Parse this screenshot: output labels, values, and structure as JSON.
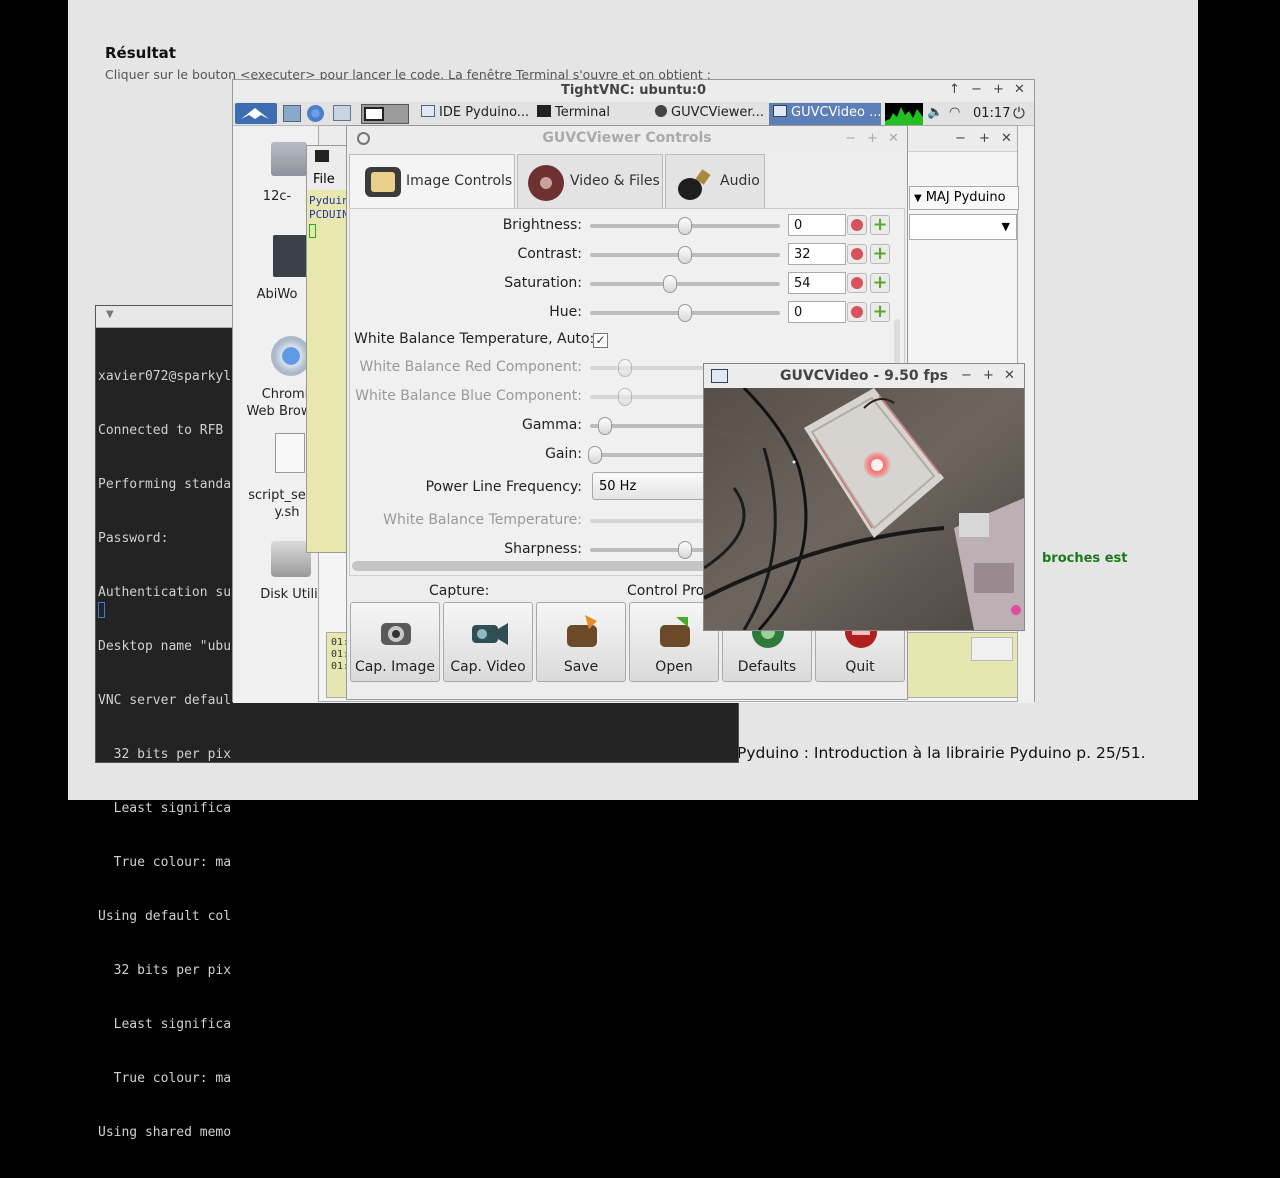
{
  "pdf": {
    "heading": "Résultat",
    "subtext": "Cliquer sur le bouton <executer> pour lancer le code. La fenêtre Terminal s'ouvre et on obtient :",
    "green_text": "broches est",
    "footer": "Pyduino : Introduction à la librairie Pyduino p. 25/51."
  },
  "terminal": {
    "lines": [
      "xavier072@sparkyl",
      "Connected to RFB ",
      "Performing standa",
      "Password:",
      "Authentication su",
      "Desktop name \"ubu",
      "VNC server defaul",
      "  32 bits per pix",
      "  Least significa",
      "  True colour: ma",
      "Using default col",
      "  32 bits per pix",
      "  Least significa",
      "  True colour: ma",
      "Using shared memo"
    ]
  },
  "vnc": {
    "title": "TightVNC: ubuntu:0",
    "taskbar": [
      "IDE Pyduino...",
      "Terminal",
      "GUVCViewer...",
      "GUVCVideo ..."
    ],
    "clock": "01:17",
    "desktop_icons": [
      "12c-",
      "AbiWo",
      "Chromi",
      "Web Brow",
      "script_se",
      "y.sh",
      "Disk Utili"
    ],
    "file_menu": "File",
    "yellow_lines": [
      "Pyduin",
      "PCDUIN"
    ],
    "maj_label": "MAJ Pyduino",
    "log_lines": [
      "01:1",
      "01:1",
      "01:1"
    ]
  },
  "controls": {
    "title": "GUVCViewer Controls",
    "tabs": [
      "Image Controls",
      "Video & Files",
      "Audio"
    ],
    "rows": [
      {
        "label": "Brightness:",
        "value": "0",
        "level": 0.5
      },
      {
        "label": "Contrast:",
        "value": "32",
        "level": 0.5
      },
      {
        "label": "Saturation:",
        "value": "54",
        "level": 0.42
      },
      {
        "label": "Hue:",
        "value": "0",
        "level": 0.5
      }
    ],
    "wb_auto_label": "White Balance Temperature, Auto:",
    "wb_auto_check": "✓",
    "disabled_rows": [
      "White Balance Red Component:",
      "White Balance Blue Component:"
    ],
    "gamma_label": "Gamma:",
    "gain_label": "Gain:",
    "plf_label": "Power Line Frequency:",
    "plf_value": "50 Hz",
    "wb_temp_label": "White Balance Temperature:",
    "sharpness_label": "Sharpness:",
    "capture_label": "Capture:",
    "control_profiles_label": "Control Pro",
    "buttons": [
      "Cap. Image",
      "Cap. Video",
      "Save",
      "Open",
      "Defaults",
      "Quit"
    ]
  },
  "video": {
    "title": "GUVCVideo - 9.50 fps"
  },
  "colors": {
    "selection": "#5d7fb8",
    "led": "#ff3a3a",
    "green_text": "#1a7a1a"
  }
}
